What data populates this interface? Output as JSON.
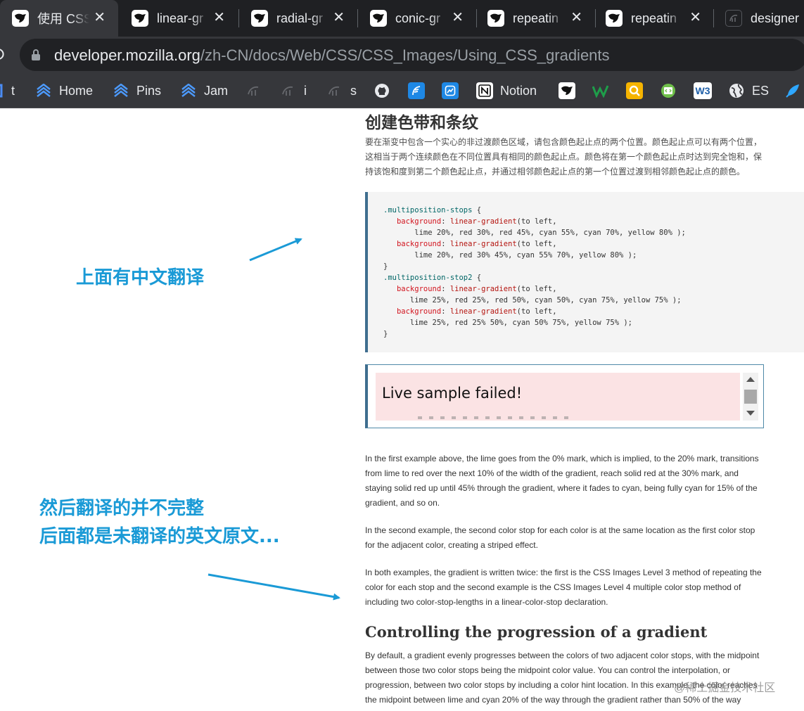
{
  "browser": {
    "tabs": [
      {
        "title": "使用 CSS",
        "active": true
      },
      {
        "title": "linear-gr",
        "active": false
      },
      {
        "title": "radial-gr",
        "active": false
      },
      {
        "title": "conic-gr",
        "active": false
      },
      {
        "title": "repeatin",
        "active": false
      },
      {
        "title": "repeatin",
        "active": false
      },
      {
        "title": "designer",
        "active": false
      }
    ],
    "url_host": "developer.mozilla.org",
    "url_path": "/zh-CN/docs/Web/CSS/CSS_Images/Using_CSS_gradients",
    "bookmarks": [
      {
        "label": "t",
        "icon": "bookmark-icon"
      },
      {
        "label": "Home",
        "icon": "jira-icon"
      },
      {
        "label": "Pins",
        "icon": "jira-icon"
      },
      {
        "label": "Jam",
        "icon": "jira-icon"
      },
      {
        "label": "",
        "icon": "yak-icon"
      },
      {
        "label": "i",
        "icon": "yak-icon"
      },
      {
        "label": "s",
        "icon": "yak-icon"
      },
      {
        "label": "",
        "icon": "github-icon"
      },
      {
        "label": "",
        "icon": "feather-icon"
      },
      {
        "label": "",
        "icon": "chart-icon"
      },
      {
        "label": "Notion",
        "icon": "notion-icon"
      },
      {
        "label": "",
        "icon": "mdn-icon"
      },
      {
        "label": "",
        "icon": "w-icon"
      },
      {
        "label": "",
        "icon": "q-icon"
      },
      {
        "label": "",
        "icon": "code-icon"
      },
      {
        "label": "",
        "icon": "w3-icon"
      },
      {
        "label": "ES",
        "icon": "globe-icon"
      },
      {
        "label": "",
        "icon": "rocket-icon"
      }
    ]
  },
  "page": {
    "heading_cn": "创建色带和条纹",
    "para_cn": "要在渐变中包含一个实心的非过渡颜色区域，请包含颜色起止点的两个位置。颜色起止点可以有两个位置，这相当于两个连续颜色在不同位置具有相同的颜色起止点。颜色将在第一个颜色起止点时达到完全饱和，保持该饱和度到第二个颜色起止点，并通过相邻颜色起止点的第一个位置过渡到相邻颜色起止点的颜色。",
    "code": [
      ".multiposition-stops {",
      "   background: linear-gradient(to left,",
      "       lime 20%, red 30%, red 45%, cyan 55%, cyan 70%, yellow 80% );",
      "   background: linear-gradient(to left,",
      "       lime 20%, red 30% 45%, cyan 55% 70%, yellow 80% );",
      "}",
      ".multiposition-stop2 {",
      "   background: linear-gradient(to left,",
      "      lime 25%, red 25%, red 50%, cyan 50%, cyan 75%, yellow 75% );",
      "   background: linear-gradient(to left,",
      "      lime 25%, red 25% 50%, cyan 50% 75%, yellow 75% );",
      "}"
    ],
    "live_sample_error": "Live sample failed!",
    "para_en_1": "In the first example above, the lime goes from the 0% mark, which is implied, to the 20% mark, transitions from lime to red over the next 10% of the width of the gradient, reach solid red at the 30% mark, and staying solid red up until 45% through the gradient, where it fades to cyan, being fully cyan for 15% of the gradient, and so on.",
    "para_en_2": "In the second example, the second color stop for each color is at the same location as the first color stop for the adjacent color, creating a striped effect.",
    "para_en_3": "In both examples, the gradient is written twice: the first is the CSS Images Level 3 method of repeating the color for each stop and the second example is the CSS Images Level 4 multiple color stop method of including two color-stop-lengths in a linear-color-stop declaration.",
    "heading_en": "Controlling the progression of a gradient",
    "para_en_4": "By default, a gradient evenly progresses between the colors of two adjacent color stops, with the midpoint between those two color stops being the midpoint color value. You can control the interpolation, or progression, between two color stops by including a color hint location. In this example, the color reaches the midpoint between lime and cyan 20% of the way through the gradient rather than 50% of the way"
  },
  "annotations": {
    "top": "上面有中文翻译",
    "bottom_line1": "然后翻译的并不完整",
    "bottom_line2": "后面都是未翻译的英文原文..."
  },
  "watermark": "@稀土掘金技术社区",
  "colors": {
    "annotation": "#1a9ad6",
    "tab_bar": "#1f2023",
    "toolbar": "#36373b",
    "code_border": "#3f6e8f",
    "error_bg": "#fbe3e4"
  }
}
